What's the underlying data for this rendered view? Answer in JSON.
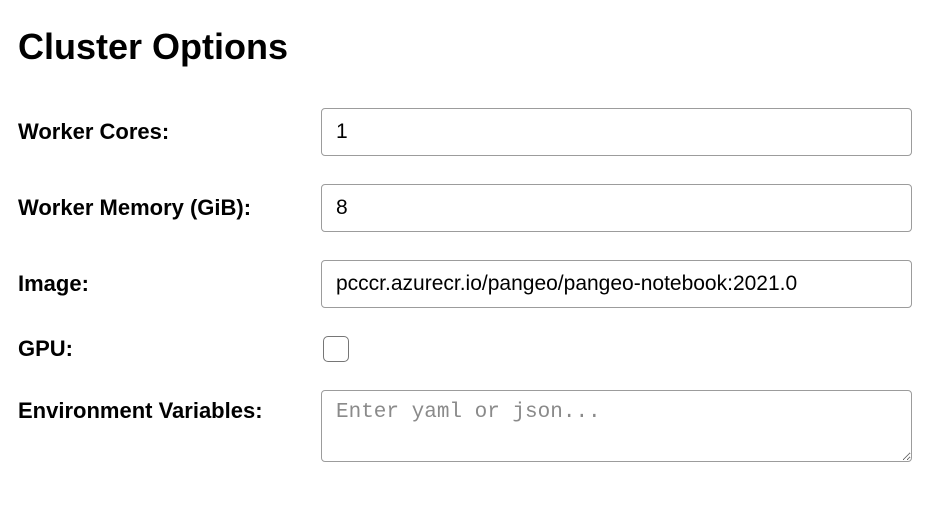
{
  "title": "Cluster Options",
  "fields": {
    "worker_cores": {
      "label": "Worker Cores:",
      "value": "1"
    },
    "worker_memory": {
      "label": "Worker Memory (GiB):",
      "value": "8"
    },
    "image": {
      "label": "Image:",
      "value": "pcccr.azurecr.io/pangeo/pangeo-notebook:2021.0"
    },
    "gpu": {
      "label": "GPU:",
      "checked": false
    },
    "env_vars": {
      "label": "Environment Variables:",
      "value": "",
      "placeholder": "Enter yaml or json..."
    }
  }
}
